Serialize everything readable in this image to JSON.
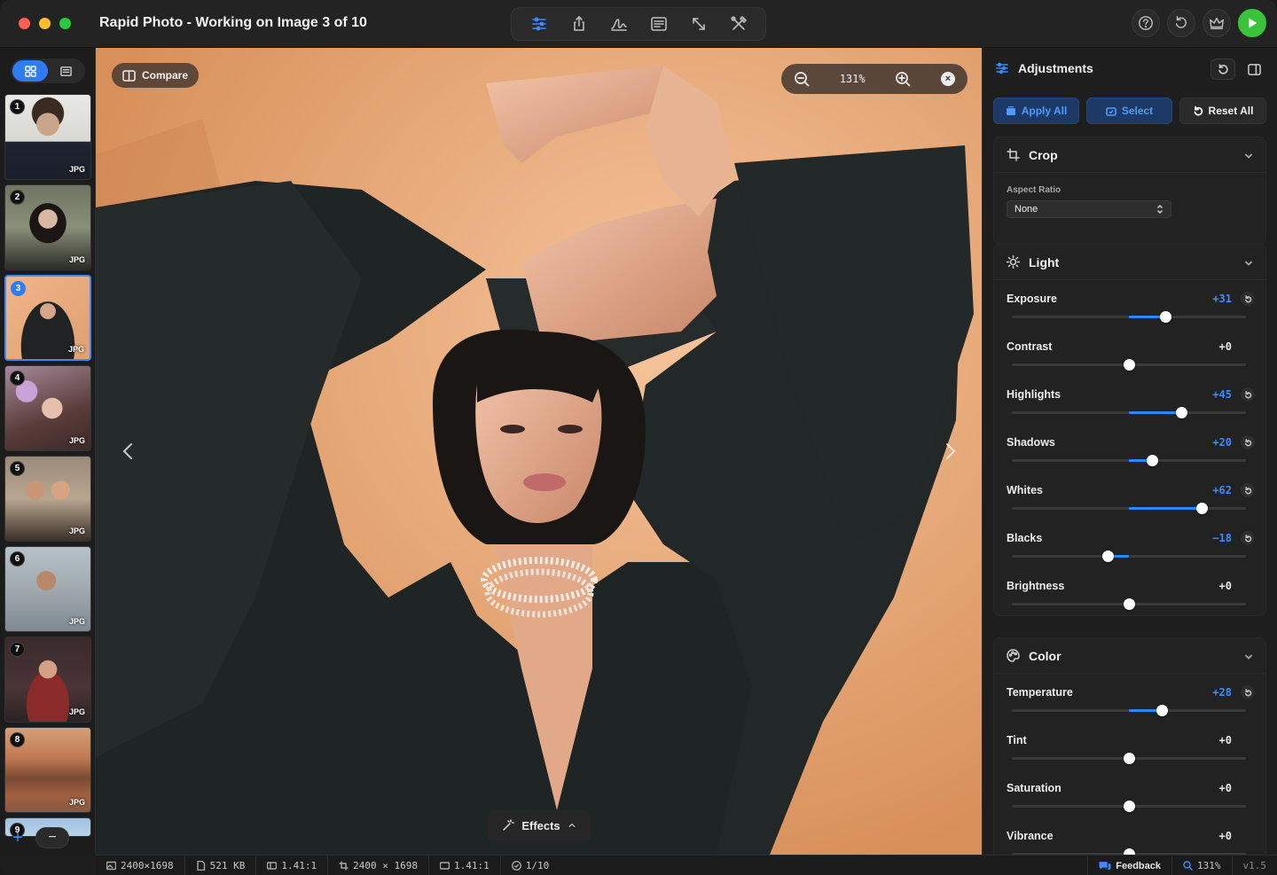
{
  "window": {
    "title": "Rapid Photo - Working on Image 3 of 10"
  },
  "toolbar": {
    "center_tools": [
      "sliders-icon",
      "share-icon",
      "signature-icon",
      "text-icon",
      "resize-icon",
      "tools-icon"
    ],
    "active_tool": "sliders-icon",
    "right": [
      "help-icon",
      "undo-icon",
      "crown-icon",
      "play-icon"
    ]
  },
  "sidebar": {
    "view_modes": [
      "grid",
      "list"
    ],
    "active_view": "grid",
    "thumbnails": [
      {
        "number": "1",
        "type": "JPG",
        "active": false
      },
      {
        "number": "2",
        "type": "JPG",
        "active": false
      },
      {
        "number": "3",
        "type": "JPG",
        "active": true
      },
      {
        "number": "4",
        "type": "JPG",
        "active": false
      },
      {
        "number": "5",
        "type": "JPG",
        "active": false
      },
      {
        "number": "6",
        "type": "JPG",
        "active": false
      },
      {
        "number": "7",
        "type": "JPG",
        "active": false
      },
      {
        "number": "8",
        "type": "JPG",
        "active": false
      },
      {
        "number": "9",
        "type": "",
        "active": false
      }
    ],
    "add_label": "+",
    "remove_label": "−"
  },
  "canvas": {
    "compare_label": "Compare",
    "zoom_value": "131%",
    "effects_label": "Effects"
  },
  "panel": {
    "title": "Adjustments",
    "actions": {
      "apply_all": "Apply All",
      "select": "Select",
      "reset_all": "Reset All"
    },
    "crop": {
      "title": "Crop",
      "aspect_ratio_label": "Aspect Ratio",
      "aspect_ratio_value": "None"
    },
    "light": {
      "title": "Light",
      "sliders": [
        {
          "label": "Exposure",
          "value": "+31",
          "numeric": 31,
          "changed": true
        },
        {
          "label": "Contrast",
          "value": "+0",
          "numeric": 0,
          "changed": false
        },
        {
          "label": "Highlights",
          "value": "+45",
          "numeric": 45,
          "changed": true
        },
        {
          "label": "Shadows",
          "value": "+20",
          "numeric": 20,
          "changed": true
        },
        {
          "label": "Whites",
          "value": "+62",
          "numeric": 62,
          "changed": true
        },
        {
          "label": "Blacks",
          "value": "−18",
          "numeric": -18,
          "changed": true
        },
        {
          "label": "Brightness",
          "value": "+0",
          "numeric": 0,
          "changed": false
        }
      ]
    },
    "color": {
      "title": "Color",
      "sliders": [
        {
          "label": "Temperature",
          "value": "+28",
          "numeric": 28,
          "changed": true
        },
        {
          "label": "Tint",
          "value": "+0",
          "numeric": 0,
          "changed": false
        },
        {
          "label": "Saturation",
          "value": "+0",
          "numeric": 0,
          "changed": false
        },
        {
          "label": "Vibrance",
          "value": "+0",
          "numeric": 0,
          "changed": false
        }
      ]
    }
  },
  "statusbar": {
    "dimensions": "2400×1698",
    "file_size": "521 KB",
    "ratio": "1.41:1",
    "crop_size": "2400 × 1698",
    "crop_ratio": "1.41:1",
    "progress": "1/10",
    "feedback": "Feedback",
    "zoom": "131%",
    "version": "v1.5"
  },
  "colors": {
    "accent": "#3d8bff",
    "play": "#3bc43b",
    "background_warm": "#e9a574"
  }
}
